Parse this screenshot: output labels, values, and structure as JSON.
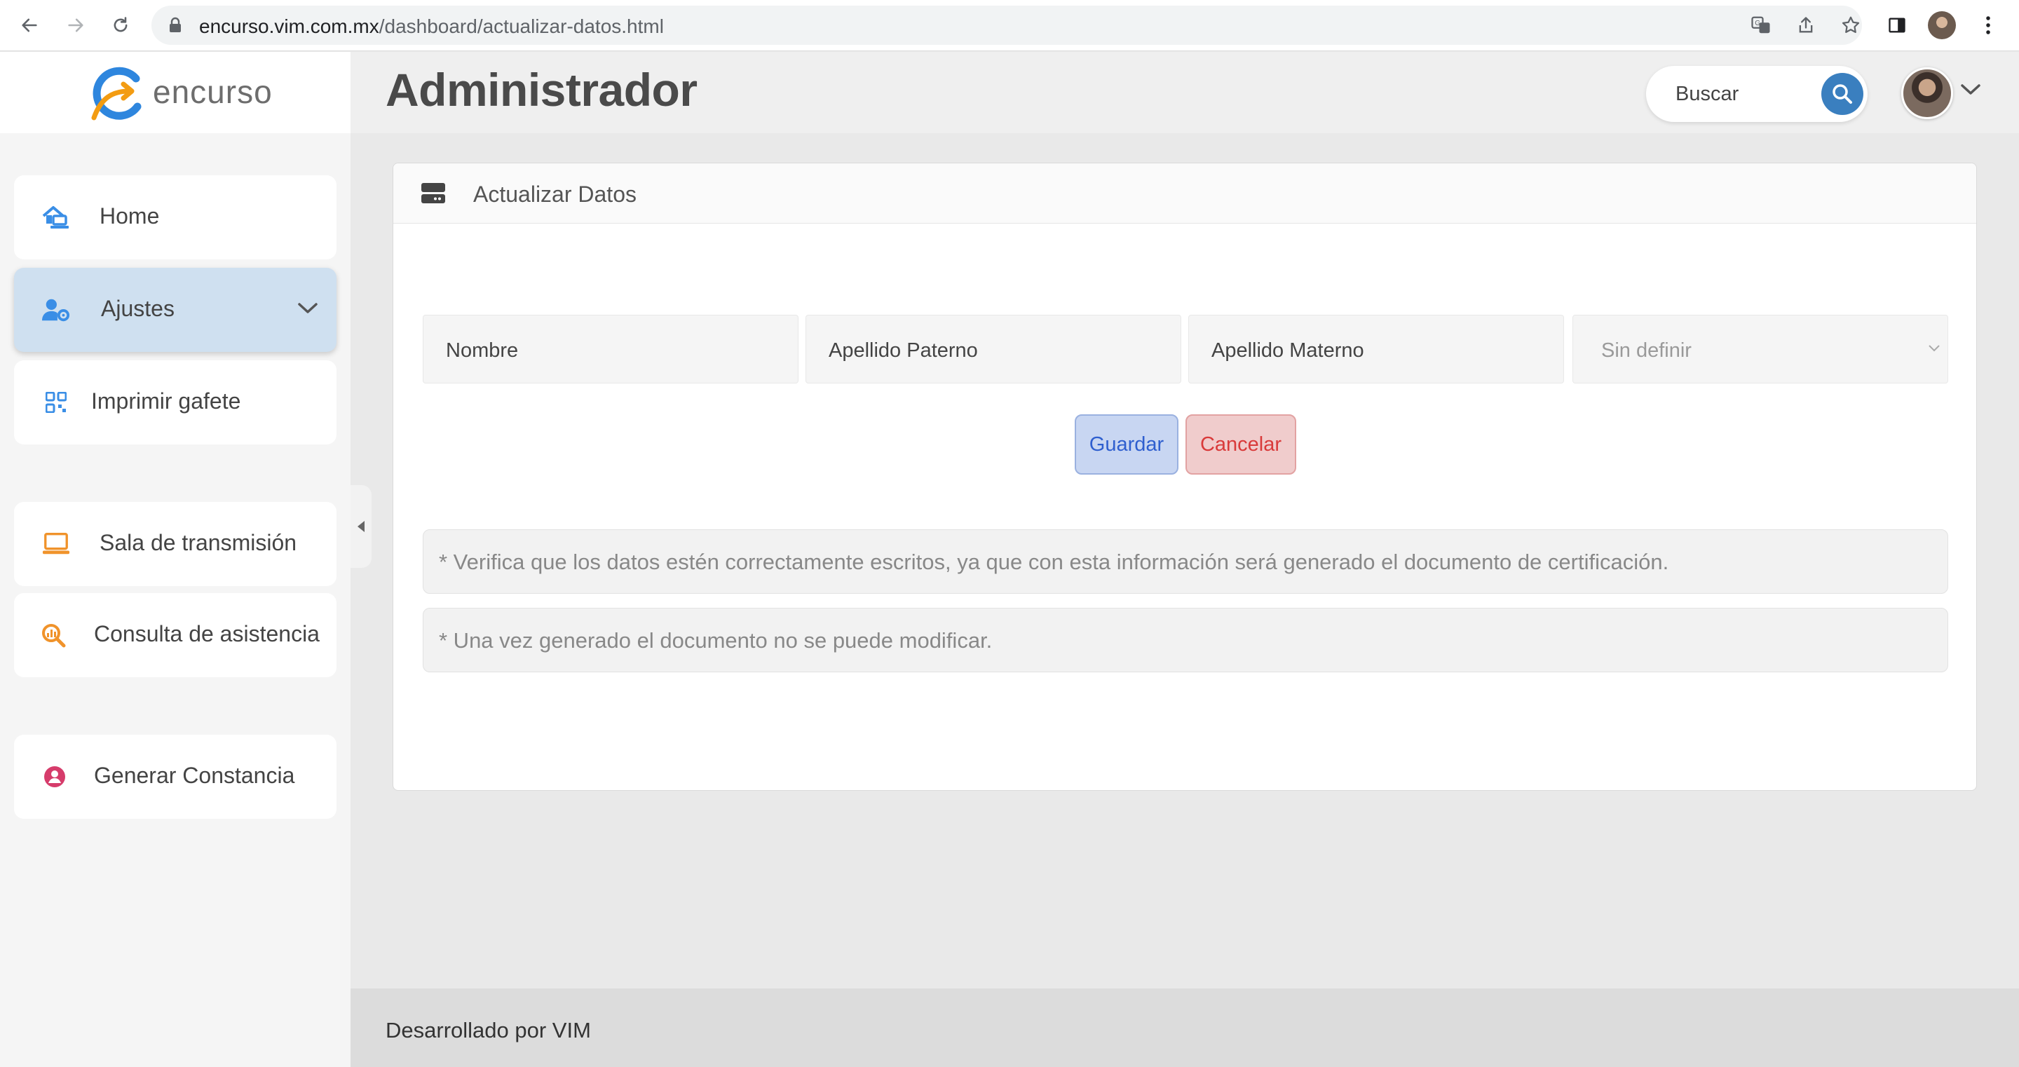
{
  "browser": {
    "url_host": "encurso.vim.com.mx",
    "url_path": "/dashboard/actualizar-datos.html"
  },
  "sidebar": {
    "logo_text": "encurso",
    "items": [
      {
        "label": "Home",
        "icon": "home-laptop-icon",
        "color": "#3a8ee6"
      },
      {
        "label": "Ajustes",
        "icon": "user-cog-icon",
        "color": "#3a8ee6",
        "active": true
      },
      {
        "label": "Imprimir gafete",
        "icon": "qr-code-icon",
        "color": "#3a8ee6"
      },
      {
        "label": "Sala de transmisión",
        "icon": "laptop-icon",
        "color": "#f0932b"
      },
      {
        "label": "Consulta de asistencia",
        "icon": "search-chart-icon",
        "color": "#f0932b"
      },
      {
        "label": "Generar Constancia",
        "icon": "user-circle-icon",
        "color": "#d63c6b"
      }
    ]
  },
  "header": {
    "title": "Administrador",
    "search_placeholder": "Buscar"
  },
  "card": {
    "title": "Actualizar Datos",
    "fields": {
      "nombre": "Nombre",
      "apellido_paterno": "Apellido Paterno",
      "apellido_materno": "Apellido Materno",
      "select_value": "Sin definir"
    },
    "buttons": {
      "save": "Guardar",
      "cancel": "Cancelar"
    },
    "notes": [
      "* Verifica que los datos estén correctamente escritos, ya que con esta información será generado el documento de certificación.",
      "* Una vez generado el documento no se puede modificar."
    ]
  },
  "footer": {
    "text": "Desarrollado por VIM"
  },
  "colors": {
    "accent": "#3a7fbf",
    "active_item_bg": "#cfe0f0",
    "save_bg": "#c8d6f2",
    "cancel_bg": "#f0cccc"
  }
}
